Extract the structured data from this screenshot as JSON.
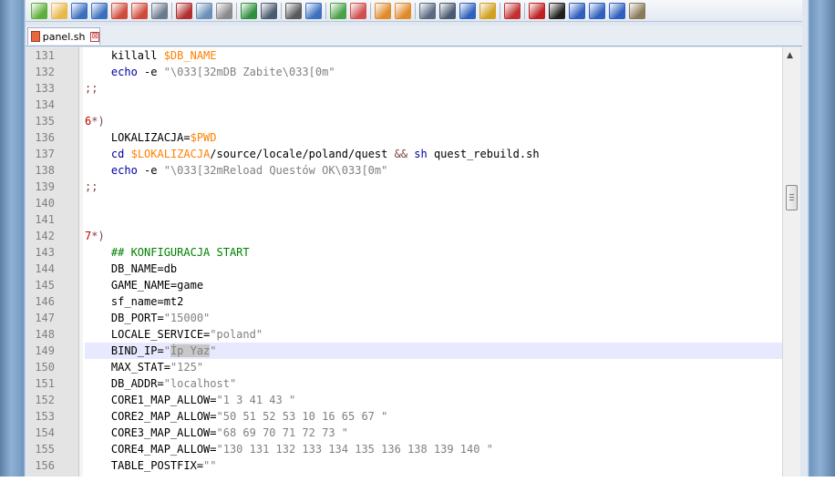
{
  "tab": {
    "filename": "panel.sh",
    "close_glyph": "⊠"
  },
  "toolbar_icons": [
    "new-file",
    "open-file",
    "save",
    "save-all",
    "close",
    "close-all",
    "print",
    "cut",
    "copy",
    "paste",
    "undo",
    "redo",
    "find",
    "replace",
    "zoom-in",
    "zoom-out",
    "sync-vertical",
    "sync-horizontal",
    "word-wrap",
    "show-all-chars",
    "indent-guide",
    "user-lang",
    "function-list",
    "record-macro",
    "stop-macro",
    "play-macro",
    "run-macro-multiple",
    "save-macro",
    "monitor"
  ],
  "lines": [
    {
      "n": "131",
      "t": [
        [
          "    killall ",
          ""
        ],
        [
          "$DB_NAME",
          "var"
        ]
      ]
    },
    {
      "n": "132",
      "t": [
        [
          "    ",
          ""
        ],
        [
          "echo",
          "kw"
        ],
        [
          " -e ",
          ""
        ],
        [
          "\"\\033[32mDB Zabite\\033[0m\"",
          "str"
        ]
      ]
    },
    {
      "n": "133",
      "t": [
        [
          ";;",
          "op"
        ]
      ]
    },
    {
      "n": "134",
      "t": []
    },
    {
      "n": "135",
      "t": [
        [
          "6",
          "num"
        ],
        [
          "*)",
          "op"
        ]
      ]
    },
    {
      "n": "136",
      "t": [
        [
          "    LOKALIZACJA=",
          ""
        ],
        [
          "$PWD",
          "var"
        ]
      ]
    },
    {
      "n": "137",
      "t": [
        [
          "    ",
          ""
        ],
        [
          "cd",
          "kw"
        ],
        [
          " ",
          ""
        ],
        [
          "$LOKALIZACJA",
          "var"
        ],
        [
          "/source/locale/poland/quest ",
          ""
        ],
        [
          "&&",
          "op"
        ],
        [
          " ",
          ""
        ],
        [
          "sh",
          "kw"
        ],
        [
          " quest_rebuild.sh",
          ""
        ]
      ]
    },
    {
      "n": "138",
      "t": [
        [
          "    ",
          ""
        ],
        [
          "echo",
          "kw"
        ],
        [
          " -e ",
          ""
        ],
        [
          "\"\\033[32mReload Questów OK\\033[0m\"",
          "str"
        ]
      ]
    },
    {
      "n": "139",
      "t": [
        [
          ";;",
          "op"
        ]
      ]
    },
    {
      "n": "140",
      "t": []
    },
    {
      "n": "141",
      "t": []
    },
    {
      "n": "142",
      "t": [
        [
          "7",
          "num"
        ],
        [
          "*)",
          "op"
        ]
      ]
    },
    {
      "n": "143",
      "t": [
        [
          "    ",
          ""
        ],
        [
          "## KONFIGURACJA START",
          "cmt"
        ]
      ]
    },
    {
      "n": "144",
      "t": [
        [
          "    DB_NAME=db",
          ""
        ]
      ]
    },
    {
      "n": "145",
      "t": [
        [
          "    GAME_NAME=game",
          ""
        ]
      ]
    },
    {
      "n": "146",
      "t": [
        [
          "    sf_name=mt2",
          ""
        ]
      ]
    },
    {
      "n": "147",
      "t": [
        [
          "    DB_PORT=",
          ""
        ],
        [
          "\"15000\"",
          "str"
        ]
      ]
    },
    {
      "n": "148",
      "t": [
        [
          "    LOCALE_SERVICE=",
          ""
        ],
        [
          "\"poland\"",
          "str"
        ]
      ]
    },
    {
      "n": "149",
      "t": [
        [
          "    BIND_IP=",
          ""
        ],
        [
          "\"",
          "str"
        ],
        [
          "İp Yaz",
          "sel"
        ],
        [
          "\"",
          "str"
        ]
      ],
      "hl": true
    },
    {
      "n": "150",
      "t": [
        [
          "    MAX_STAT=",
          ""
        ],
        [
          "\"125\"",
          "str"
        ]
      ]
    },
    {
      "n": "151",
      "t": [
        [
          "    DB_ADDR=",
          ""
        ],
        [
          "\"localhost\"",
          "str"
        ]
      ]
    },
    {
      "n": "152",
      "t": [
        [
          "    CORE1_MAP_ALLOW=",
          ""
        ],
        [
          "\"1 3 41 43 \"",
          "str"
        ]
      ]
    },
    {
      "n": "153",
      "t": [
        [
          "    CORE2_MAP_ALLOW=",
          ""
        ],
        [
          "\"50 51 52 53 10 16 65 67 \"",
          "str"
        ]
      ]
    },
    {
      "n": "154",
      "t": [
        [
          "    CORE3_MAP_ALLOW=",
          ""
        ],
        [
          "\"68 69 70 71 72 73 \"",
          "str"
        ]
      ]
    },
    {
      "n": "155",
      "t": [
        [
          "    CORE4_MAP_ALLOW=",
          ""
        ],
        [
          "\"130 131 132 133 134 135 136 138 139 140 \"",
          "str"
        ]
      ]
    },
    {
      "n": "156",
      "t": [
        [
          "    TABLE_POSTFIX=",
          ""
        ],
        [
          "\"\"",
          "str"
        ]
      ]
    }
  ],
  "colors": {
    "variable": "#ff8000",
    "keyword": "#0000a0",
    "string": "#808080",
    "comment": "#008000",
    "number": "#c00000",
    "current_line": "#e8e8ff"
  }
}
